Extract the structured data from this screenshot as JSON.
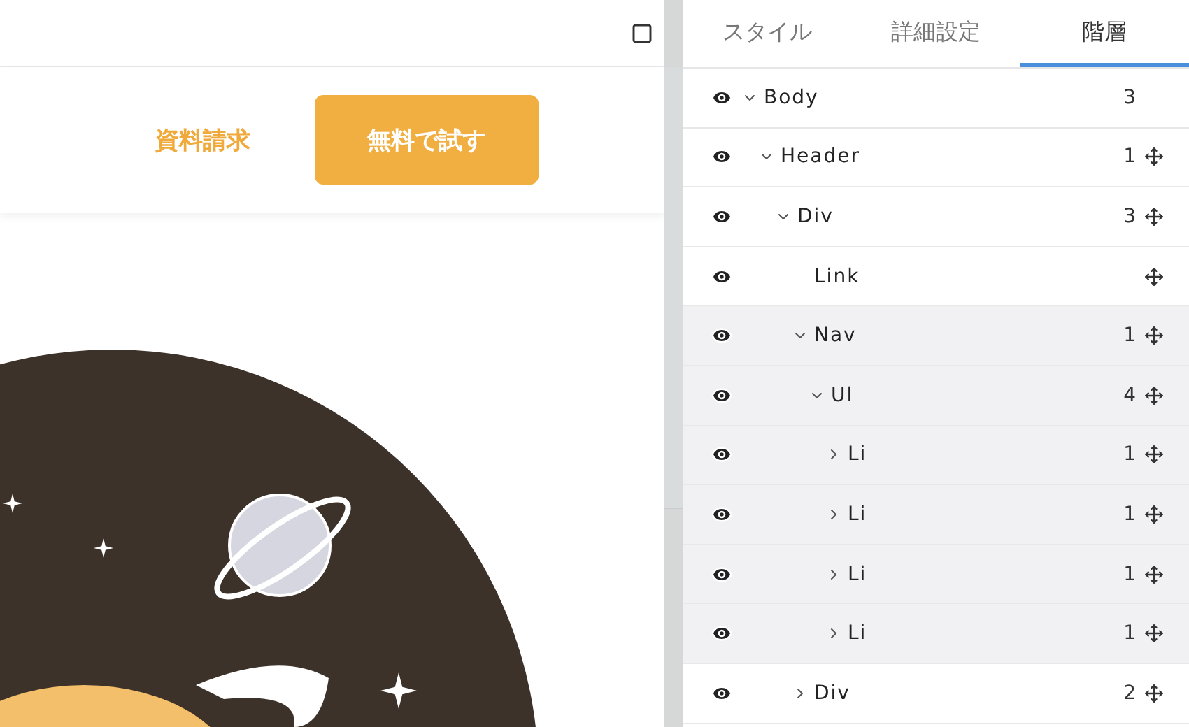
{
  "page_header": {
    "link": "資料請求",
    "button": "無料で試す"
  },
  "panel": {
    "tabs": [
      {
        "label": "スタイル",
        "selected": false
      },
      {
        "label": "詳細設定",
        "selected": false
      },
      {
        "label": "階層",
        "selected": true
      }
    ],
    "tree": [
      {
        "label": "Body",
        "expanded": true,
        "count": "3",
        "movable": false,
        "selected": false,
        "children": [
          {
            "label": "Header",
            "expanded": true,
            "count": "1",
            "movable": true,
            "selected": false,
            "children": [
              {
                "label": "Div",
                "expanded": true,
                "count": "3",
                "movable": true,
                "selected": false,
                "children": [
                  {
                    "label": "Link",
                    "movable": true,
                    "selected": false
                  },
                  {
                    "label": "Nav",
                    "expanded": true,
                    "count": "1",
                    "movable": true,
                    "selected": true,
                    "children": [
                      {
                        "label": "Ul",
                        "expanded": true,
                        "count": "4",
                        "movable": true,
                        "selected": true,
                        "children": [
                          {
                            "label": "Li",
                            "expanded": false,
                            "count": "1",
                            "movable": true,
                            "selected": true
                          },
                          {
                            "label": "Li",
                            "expanded": false,
                            "count": "1",
                            "movable": true,
                            "selected": true
                          },
                          {
                            "label": "Li",
                            "expanded": false,
                            "count": "1",
                            "movable": true,
                            "selected": true
                          },
                          {
                            "label": "Li",
                            "expanded": false,
                            "count": "1",
                            "movable": true,
                            "selected": true
                          }
                        ]
                      }
                    ]
                  },
                  {
                    "label": "Div",
                    "expanded": false,
                    "count": "2",
                    "movable": true,
                    "selected": false
                  }
                ]
              }
            ]
          }
        ]
      }
    ]
  }
}
